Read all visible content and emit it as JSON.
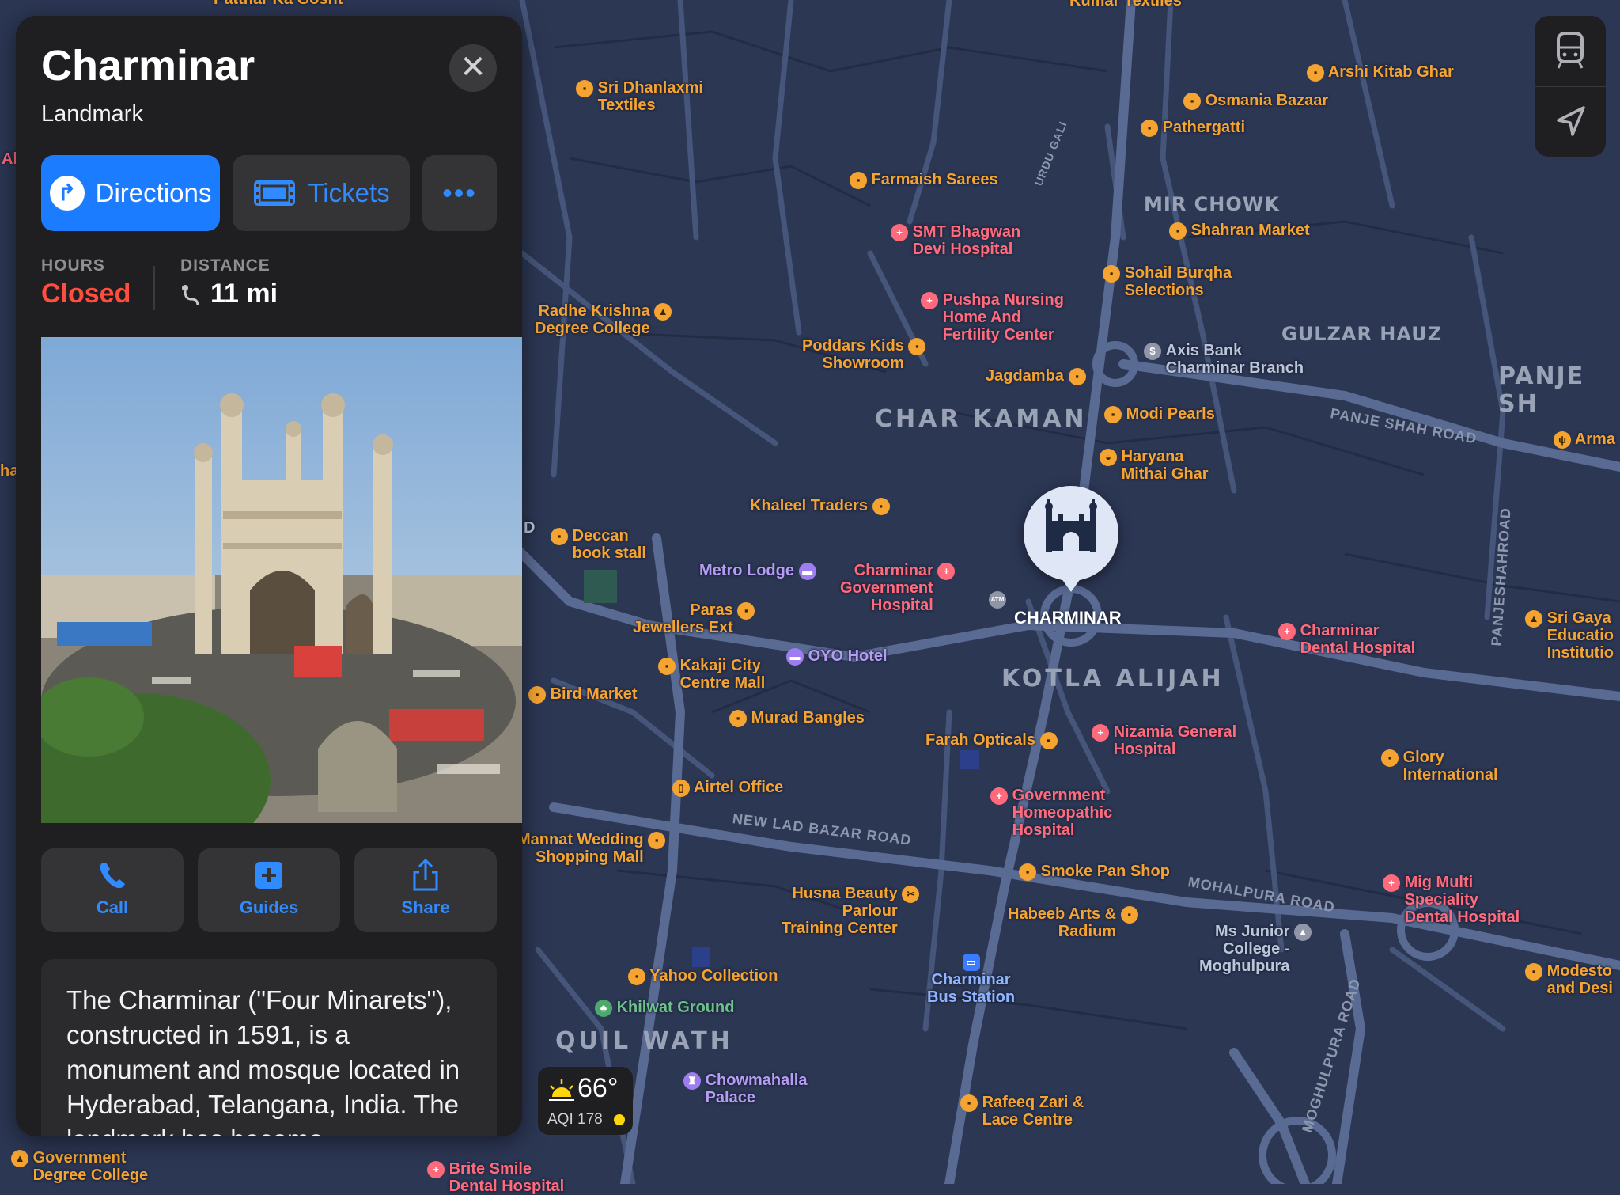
{
  "place": {
    "title": "Charminar",
    "category": "Landmark",
    "close_icon": "close-icon",
    "actions": {
      "directions": "Directions",
      "tickets": "Tickets",
      "more": "•••"
    },
    "hours_caption": "HOURS",
    "hours_value": "Closed",
    "distance_caption": "DISTANCE",
    "distance_value": "11 mi",
    "quick_actions": {
      "call": "Call",
      "guides": "Guides",
      "share": "Share"
    },
    "description": "The Charminar (\"Four Minarets\"), constructed in 1591, is a monument and mosque located in Hyderabad, Telangana, India. The landmark has become..."
  },
  "weather": {
    "temp": "66°",
    "aqi": "AQI 178"
  },
  "map": {
    "pin_label": "CHARMINAR",
    "areas": {
      "char_kaman": "CHAR KAMAN",
      "kotla_alijah": "KOTLA ALIJAH",
      "quil_wath": "QUIL WATH",
      "mir_chowk": "MIR CHOWK",
      "gulzar_hauz": "GULZAR HAUZ",
      "panje_sh": "PANJE SH"
    },
    "roads": {
      "new_lad_bazar": "NEW LAD BAZAR ROAD",
      "mohalpura": "MOHALPURA ROAD",
      "panje_shah": "PANJE SHAH ROAD",
      "moghulpura": "MOGHULPURA ROAD",
      "panjeshah_vertical": "PANJESHAHROAD",
      "urdu_gali": "URDU GALI"
    },
    "places": {
      "pathar": "Patthar Ka Gosht",
      "kumar": "Kumar Textiles",
      "dhanlaxmi": "Sri Dhanlaxmi\nTextiles",
      "arshi": "Arshi Kitab Ghar",
      "osmania": "Osmania Bazaar",
      "pathergatti": "Pathergatti",
      "farmaish": "Farmaish Sarees",
      "shahran": "Shahran Market",
      "smt": "SMT Bhagwan\nDevi Hospital",
      "sohail": "Sohail Burqha\nSelections",
      "pushpa": "Pushpa Nursing\nHome And\nFertility Center",
      "radhe": "Radhe Krishna\nDegree College",
      "poddars": "Poddars Kids\nShowroom",
      "axis": "Axis Bank\nCharminar Branch",
      "jagdamba": "Jagdamba",
      "modi": "Modi Pearls",
      "arma": "Arma",
      "haryana": "Haryana\nMithai Ghar",
      "khaleel": "Khaleel Traders",
      "deccan": "Deccan\nbook stall",
      "metro": "Metro Lodge",
      "charminar_govt": "Charminar\nGovernment\nHospital",
      "atm": "ATM",
      "paras": "Paras\nJewellers Ext",
      "sri_gaya": "Sri Gaya\nEducatio\nInstitutio",
      "charminar_dental": "Charminar\nDental Hospital",
      "kakaji": "Kakaji City\nCentre Mall",
      "oyo": "OYO Hotel",
      "bird": "Bird Market",
      "murad": "Murad Bangles",
      "nizamia": "Nizamia General\nHospital",
      "farah": "Farah Opticals",
      "glory": "Glory\nInternational",
      "airtel": "Airtel Office",
      "homeopathic": "Government\nHomeopathic\nHospital",
      "mannat": "Mannat Wedding\nShopping Mall",
      "smoke": "Smoke Pan Shop",
      "mig": "Mig Multi\nSpeciality\nDental Hospital",
      "husna": "Husna Beauty\nParlour\nTraining Center",
      "habeeb": "Habeeb Arts &\nRadium",
      "msjunior": "Ms Junior\nCollege -\nMoghulpura",
      "modesto": "Modesto\nand Desi",
      "yahoo": "Yahoo Collection",
      "bus": "Charminar\nBus Station",
      "khilwat": "Khilwat Ground",
      "chowmahalla": "Chowmahalla\nPalace",
      "rafeeq": "Rafeeq Zari &\nLace Centre",
      "govt_degree": "Government\nDegree College",
      "brite": "Brite Smile\nDental Hospital",
      "al": "Al",
      "ha": "ha",
      "d_edge": "D"
    }
  },
  "colors": {
    "map_bg": "#2c3754",
    "business": "#f5a431",
    "medical": "#ff6b7d",
    "accent": "#1b7cff",
    "closed": "#ff4d3e"
  }
}
